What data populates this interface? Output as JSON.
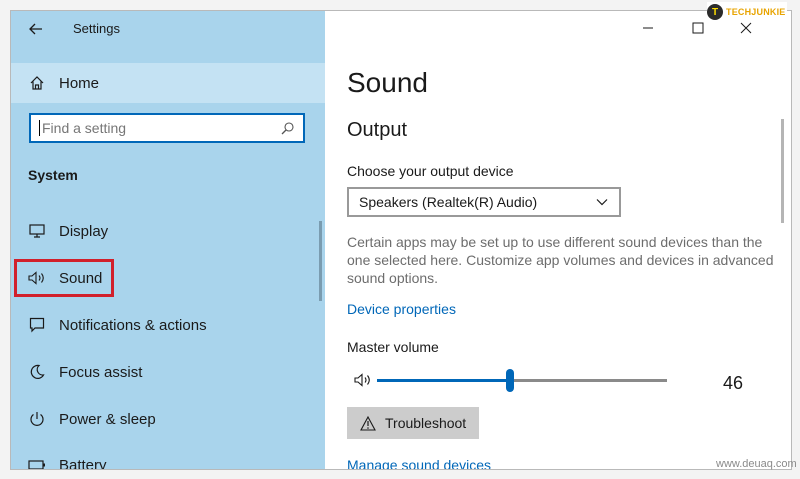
{
  "window": {
    "title": "Settings"
  },
  "brand": {
    "logo_letter": "T",
    "text": "TECHJUNKIE"
  },
  "sidebar": {
    "home_label": "Home",
    "search_placeholder": "Find a setting",
    "section": "System",
    "items": [
      {
        "label": "Display",
        "icon": "monitor-icon"
      },
      {
        "label": "Sound",
        "icon": "speaker-icon",
        "selected": true
      },
      {
        "label": "Notifications & actions",
        "icon": "notification-icon"
      },
      {
        "label": "Focus assist",
        "icon": "moon-icon"
      },
      {
        "label": "Power & sleep",
        "icon": "power-icon"
      },
      {
        "label": "Battery",
        "icon": "battery-icon"
      }
    ]
  },
  "main": {
    "title": "Sound",
    "output_heading": "Output",
    "device_label": "Choose your output device",
    "device_value": "Speakers (Realtek(R) Audio)",
    "description_lines": [
      "Certain apps may be set up to use different sound devices than the",
      "one selected here. Customize app volumes and devices in advanced",
      "sound options."
    ],
    "device_properties_link": "Device properties",
    "master_volume_label": "Master volume",
    "volume_value": "46",
    "troubleshoot_label": "Troubleshoot",
    "manage_link": "Manage sound devices"
  },
  "watermark": "www.deuaq.com",
  "colors": {
    "sidebar_bg": "#a9d4ec",
    "accent": "#0067b8",
    "highlight": "#d1202b",
    "link": "#0067b8"
  }
}
